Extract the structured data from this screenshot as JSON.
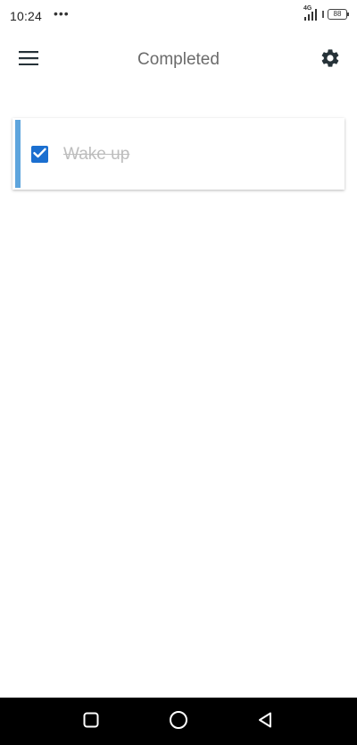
{
  "status_bar": {
    "time": "10:24",
    "dots": "•••",
    "network": "4G",
    "battery": "88"
  },
  "app_bar": {
    "title": "Completed",
    "menu_icon": "hamburger-menu-icon",
    "settings_icon": "gear-icon"
  },
  "tasks": [
    {
      "label": "Wake up",
      "checked": true,
      "accent_color": "#5ea5dd"
    }
  ],
  "nav_bar": {
    "recents_icon": "square-icon",
    "home_icon": "circle-icon",
    "back_icon": "triangle-back-icon"
  },
  "colors": {
    "checkbox": "#1b6fd0",
    "title_text": "#6b6b6b",
    "completed_text": "#bdbdbd",
    "icon_dark": "#263238"
  }
}
